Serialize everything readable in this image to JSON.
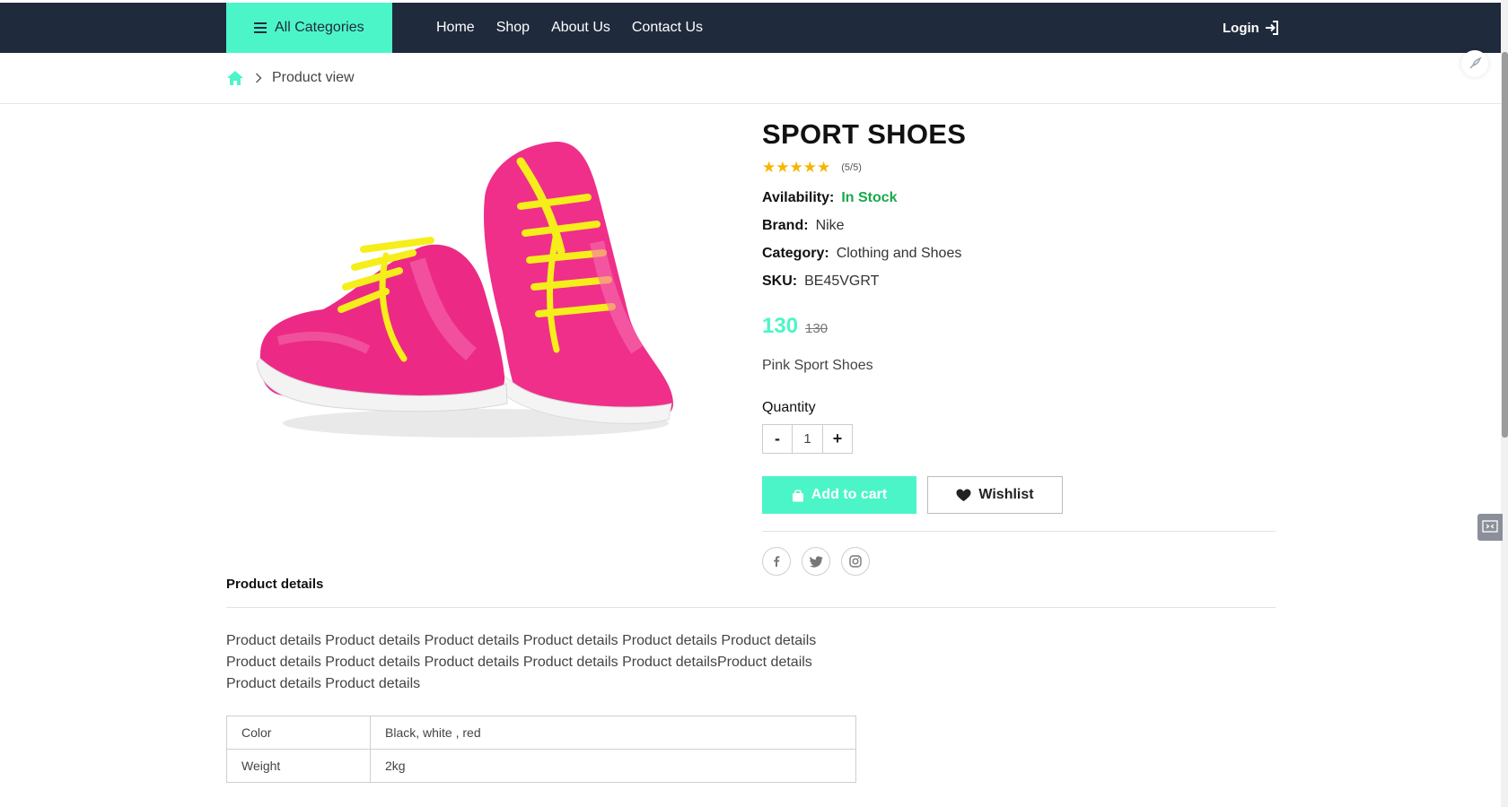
{
  "navbar": {
    "all_categories": "All Categories",
    "links": [
      "Home",
      "Shop",
      "About Us",
      "Contact Us"
    ],
    "login": "Login"
  },
  "breadcrumb": {
    "current": "Product view"
  },
  "product": {
    "title": "SPORT SHOES",
    "rating_text": "(5/5)",
    "stars": 5,
    "availability_label": "Avilability:",
    "availability_value": "In Stock",
    "brand_label": "Brand:",
    "brand_value": "Nike",
    "category_label": "Category:",
    "category_value": "Clothing and Shoes",
    "sku_label": "SKU:",
    "sku_value": "BE45VGRT",
    "price_now": "130",
    "price_old": "130",
    "short_description": "Pink Sport Shoes",
    "quantity_label": "Quantity",
    "quantity_minus": "-",
    "quantity_value": "1",
    "quantity_plus": "+",
    "add_to_cart": "Add to cart",
    "wishlist": "Wishlist"
  },
  "details": {
    "title": "Product details",
    "text": "Product details Product details Product details Product details Product details Product details Product details Product details Product details Product details Product detailsProduct details Product details Product details",
    "specs": [
      {
        "key": "Color",
        "value": "Black, white , red"
      },
      {
        "key": "Weight",
        "value": "2kg"
      }
    ]
  },
  "colors": {
    "nav_bg": "#1f2a3c",
    "accent": "#4cf5c8",
    "in_stock": "#19a94a",
    "star": "#f7b500"
  },
  "icons": [
    "menu-icon",
    "login-icon",
    "home-icon",
    "chevron-right-icon",
    "star-icon",
    "shopping-bag-icon",
    "heart-icon",
    "facebook-icon",
    "twitter-icon",
    "instagram-icon",
    "rocket-icon",
    "chat-icon"
  ]
}
